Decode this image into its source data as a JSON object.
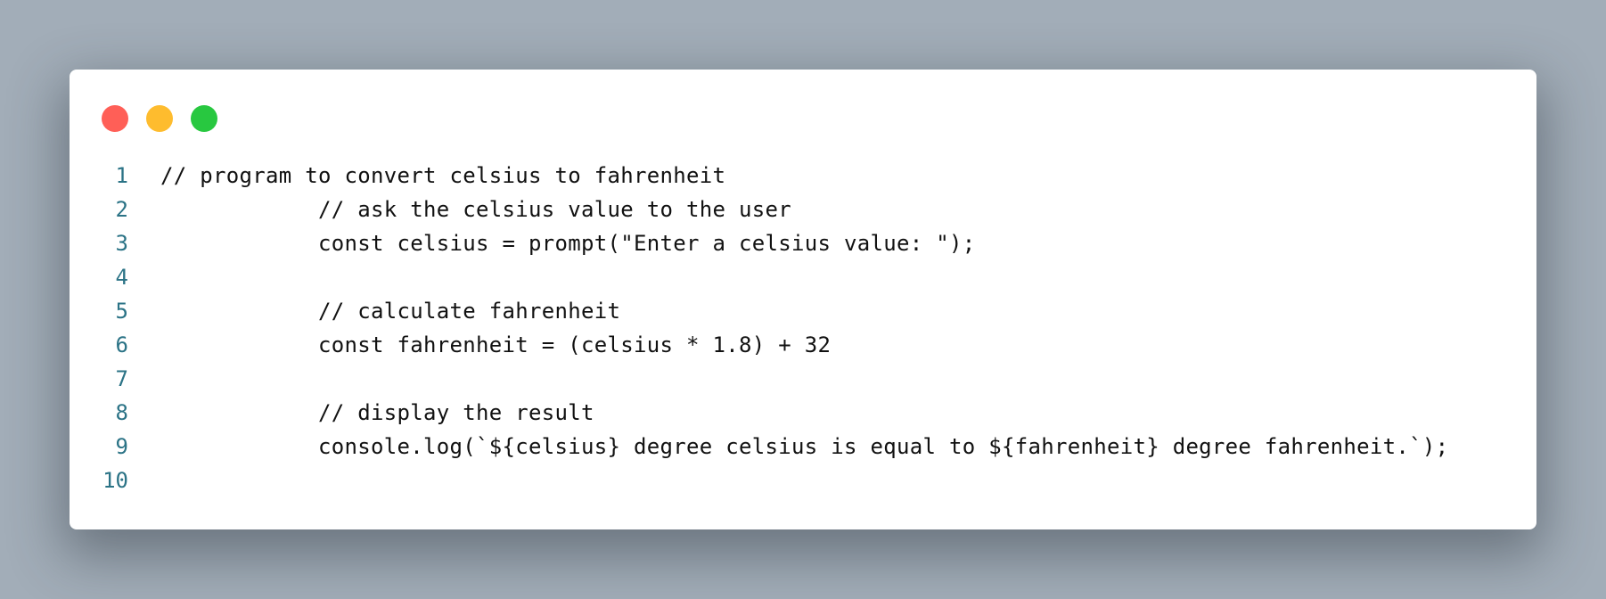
{
  "colors": {
    "background": "#a2adb8",
    "window": "#ffffff",
    "line_number": "#2b7386",
    "code_text": "#111111",
    "traffic_close": "#ff5f57",
    "traffic_minimize": "#febc2e",
    "traffic_maximize": "#28c840"
  },
  "code": {
    "lines": [
      {
        "n": "1",
        "text": "// program to convert celsius to fahrenheit"
      },
      {
        "n": "2",
        "text": "            // ask the celsius value to the user"
      },
      {
        "n": "3",
        "text": "            const celsius = prompt(\"Enter a celsius value: \");"
      },
      {
        "n": "4",
        "text": ""
      },
      {
        "n": "5",
        "text": "            // calculate fahrenheit"
      },
      {
        "n": "6",
        "text": "            const fahrenheit = (celsius * 1.8) + 32"
      },
      {
        "n": "7",
        "text": ""
      },
      {
        "n": "8",
        "text": "            // display the result"
      },
      {
        "n": "9",
        "text": "            console.log(`${celsius} degree celsius is equal to ${fahrenheit} degree fahrenheit.`);"
      },
      {
        "n": "10",
        "text": ""
      }
    ]
  }
}
